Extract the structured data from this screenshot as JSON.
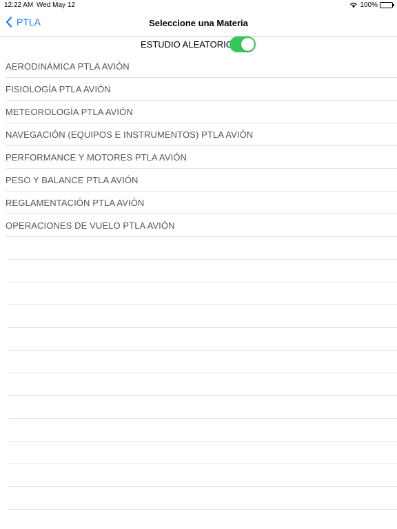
{
  "status_bar": {
    "time": "12:22 AM",
    "date": "Wed May 12",
    "battery": "100%",
    "wifi_icon": "wifi-icon",
    "battery_icon": "battery-icon"
  },
  "nav": {
    "back_label": "PTLA",
    "back_icon": "chevron-left-icon",
    "title": "Seleccione una Materia",
    "accent_color": "#1a7cf5"
  },
  "toggle": {
    "label": "ESTUDIO ALEATORIO",
    "on": true,
    "color": "#34c759"
  },
  "subjects": [
    "AERODINÁMICA PTLA AVIÓN",
    "FISIOLOGÍA PTLA AVIÓN",
    "METEOROLOGÍA PTLA AVIÓN",
    "NAVEGACIÓN (EQUIPOS E INSTRUMENTOS) PTLA AVIÓN",
    "PERFORMANCE Y MOTORES PTLA AVIÓN",
    "PESO Y BALANCE PTLA AVIÓN",
    "REGLAMENTACIÓN PTLA AVIÓN",
    "OPERACIONES DE VUELO PTLA AVIÓN"
  ]
}
